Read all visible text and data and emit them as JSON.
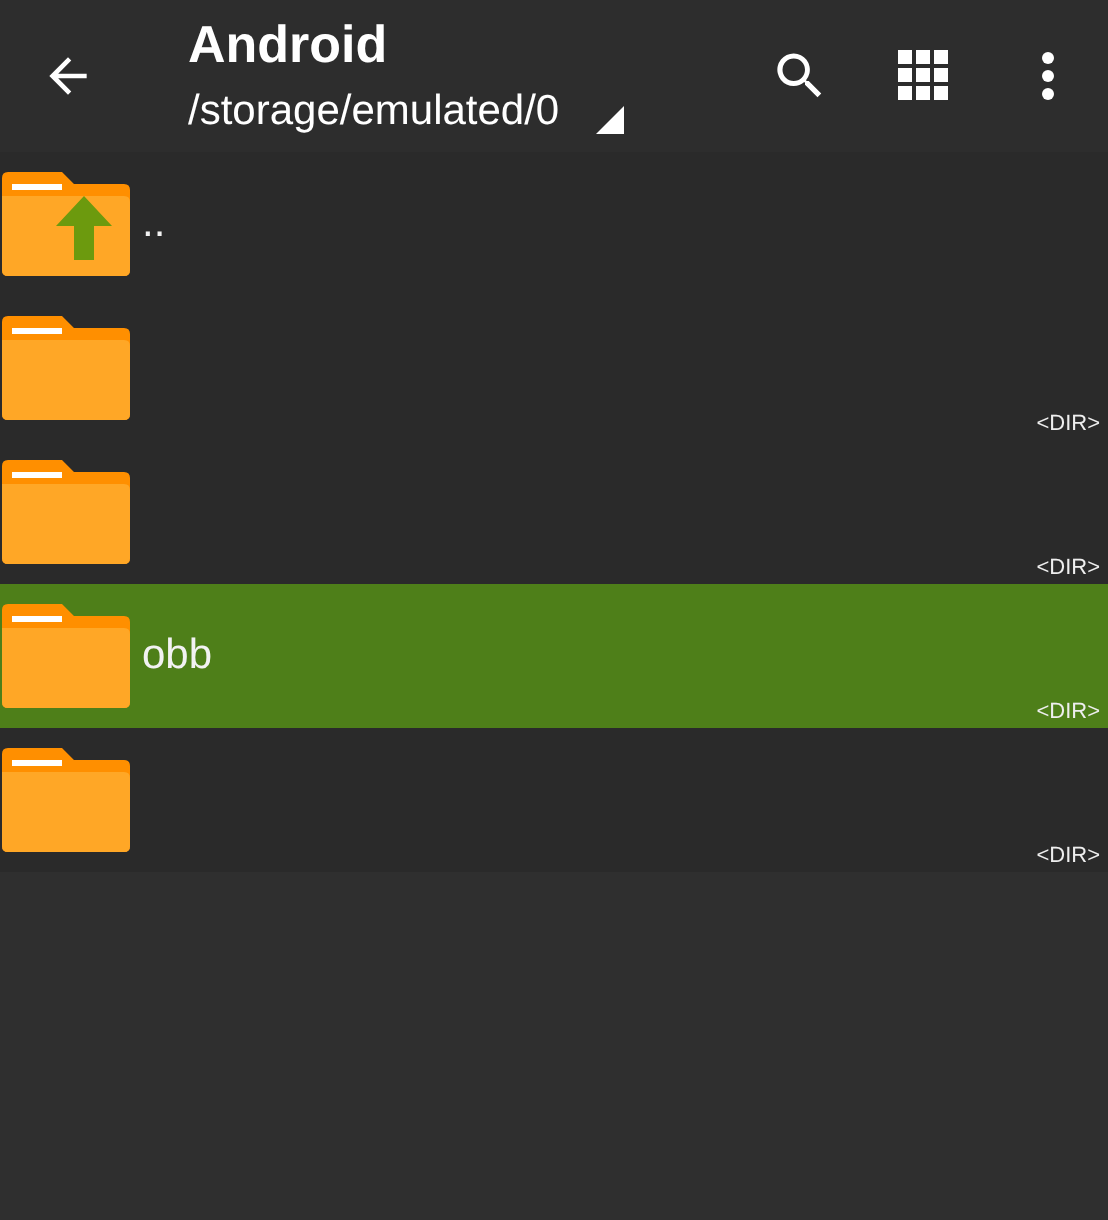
{
  "toolbar": {
    "title": "Android",
    "path": "/storage/emulated/0"
  },
  "items": [
    {
      "kind": "parent",
      "name": "..",
      "selected": false
    },
    {
      "kind": "folder",
      "info": "<DIR>",
      "selected": false
    },
    {
      "kind": "folder",
      "info": "<DIR>",
      "selected": false
    },
    {
      "kind": "folder",
      "name": "obb",
      "info": "<DIR>",
      "selected": true
    },
    {
      "kind": "folder",
      "info": "<DIR>",
      "selected": false
    }
  ]
}
